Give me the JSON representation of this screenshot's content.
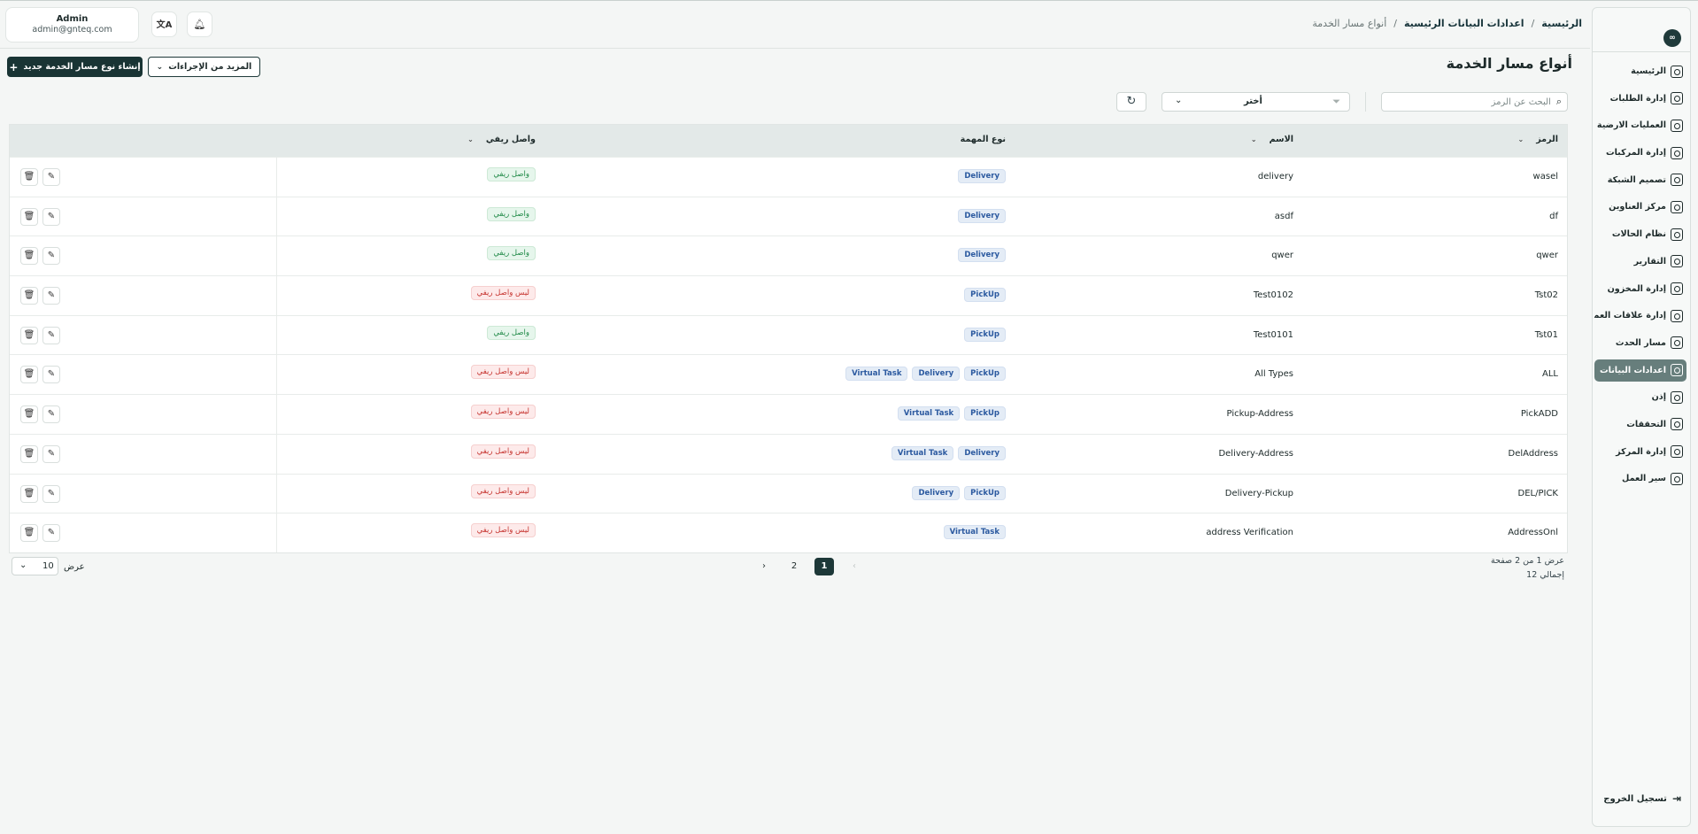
{
  "header": {
    "breadcrumb": [
      "الرئيسية",
      "اعدادات البيانات الرئيسية",
      "أنواع مسار الخدمة"
    ],
    "user": {
      "name": "Admin",
      "email": "admin@gnteq.com"
    },
    "logo": "∞"
  },
  "sidebar": {
    "items": [
      {
        "label": "الرئيسية",
        "icon": "dashboard-icon"
      },
      {
        "label": "إدارة الطلبات",
        "icon": "orders-icon"
      },
      {
        "label": "العمليات الارضية",
        "icon": "ground-ops-icon"
      },
      {
        "label": "إدارة المركبات",
        "icon": "truck-icon"
      },
      {
        "label": "تصميم الشبكة",
        "icon": "network-icon"
      },
      {
        "label": "مركز العناوين",
        "icon": "location-icon"
      },
      {
        "label": "نظام الحالات",
        "icon": "status-icon"
      },
      {
        "label": "التقارير",
        "icon": "reports-icon"
      },
      {
        "label": "إدارة المخزون",
        "icon": "inventory-icon"
      },
      {
        "label": "إدارة علاقات العملاء",
        "icon": "crm-icon"
      },
      {
        "label": "مسار الحدث",
        "icon": "event-route-icon"
      },
      {
        "label": "اعدادات البيانات",
        "icon": "database-icon",
        "active": true
      },
      {
        "label": "إذن",
        "icon": "user-icon"
      },
      {
        "label": "التحققات",
        "icon": "tools-icon"
      },
      {
        "label": "إدارة المركز",
        "icon": "center-icon"
      },
      {
        "label": "سير العمل",
        "icon": "workflow-icon"
      }
    ],
    "logout": "تسجيل الخروج"
  },
  "page": {
    "title": "أنواع مسار الخدمة",
    "create_label": "إنشاء نوع مسار الخدمة جديد",
    "more_actions_label": "المزيد من الإجراءات"
  },
  "filters": {
    "search_placeholder": "البحث عن الرمز",
    "select_value": "أختر"
  },
  "table": {
    "headers": {
      "code": "الرمز",
      "name": "الاسم",
      "task_type": "نوع المهمة",
      "connected": "واصل ريفي"
    },
    "rows": [
      {
        "code": "wasel",
        "name": "delivery",
        "types": [
          "Delivery"
        ],
        "status": "واصل ريفي",
        "ok": true
      },
      {
        "code": "df",
        "name": "asdf",
        "types": [
          "Delivery"
        ],
        "status": "واصل ريفي",
        "ok": true
      },
      {
        "code": "qwer",
        "name": "qwer",
        "types": [
          "Delivery"
        ],
        "status": "واصل ريفي",
        "ok": true
      },
      {
        "code": "Tst02",
        "name": "Test0102",
        "types": [
          "PickUp"
        ],
        "status": "ليس واصل ريفي",
        "ok": false
      },
      {
        "code": "Tst01",
        "name": "Test0101",
        "types": [
          "PickUp"
        ],
        "status": "واصل ريفي",
        "ok": true
      },
      {
        "code": "ALL",
        "name": "All Types",
        "types": [
          "PickUp",
          "Delivery",
          "Virtual Task"
        ],
        "status": "ليس واصل ريفي",
        "ok": false
      },
      {
        "code": "PickADD",
        "name": "Pickup-Address",
        "types": [
          "PickUp",
          "Virtual Task"
        ],
        "status": "ليس واصل ريفي",
        "ok": false
      },
      {
        "code": "DelAddress",
        "name": "Delivery-Address",
        "types": [
          "Delivery",
          "Virtual Task"
        ],
        "status": "ليس واصل ريفي",
        "ok": false
      },
      {
        "code": "DEL/PICK",
        "name": "Delivery-Pickup",
        "types": [
          "PickUp",
          "Delivery"
        ],
        "status": "ليس واصل ريفي",
        "ok": false
      },
      {
        "code": "AddressOnl",
        "name": "address Verification",
        "types": [
          "Virtual Task"
        ],
        "status": "ليس واصل ريفي",
        "ok": false
      }
    ]
  },
  "pagination": {
    "info_line1": "عرض 1 من 2 صفحة",
    "info_line2": "إجمالي 12",
    "pages": [
      "1",
      "2"
    ],
    "current": "1",
    "per_page_label": "عرض",
    "per_page": "10"
  }
}
